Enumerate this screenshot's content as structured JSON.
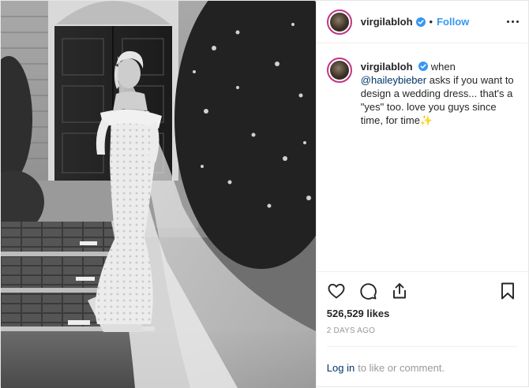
{
  "post": {
    "username": "virgilabloh",
    "follow_label": "Follow",
    "dot": "•",
    "caption": {
      "username": "virgilabloh",
      "text_before": "when ",
      "mention": "@haileybieber",
      "text_after": " asks if you want to design a wedding dress... that's a \"yes\" too. love you guys since time, for time",
      "emoji": "✨"
    },
    "likes": "526,529 likes",
    "time_ago": "2 DAYS AGO",
    "login_link": "Log in",
    "login_suffix": "to like or comment."
  },
  "icons": {
    "like": "heart-icon",
    "comment": "comment-icon",
    "share": "share-icon",
    "save": "bookmark-icon",
    "verified": "verified-badge-icon",
    "more": "more-options-icon"
  },
  "colors": {
    "follow": "#3897f0",
    "link": "#003569",
    "muted": "#999999",
    "verified": "#3897f0",
    "avatar_ring": "#c13584"
  }
}
